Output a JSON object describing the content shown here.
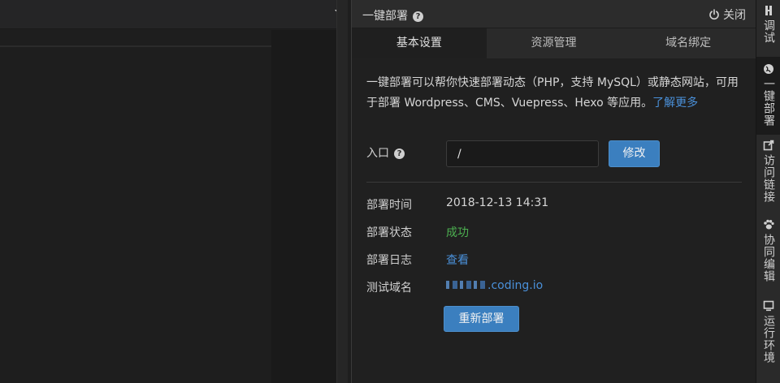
{
  "panel": {
    "title": "一键部署",
    "close_label": "关闭",
    "tabs": [
      "基本设置",
      "资源管理",
      "域名绑定"
    ],
    "description_text": "一键部署可以帮你快速部署动态（PHP，支持 MySQL）或静态网站，可用于部署 Wordpress、CMS、Vuepress、Hexo 等应用。",
    "learn_more_link": "了解更多",
    "entry_label": "入口",
    "entry_value": "/",
    "modify_button": "修改",
    "deploy_time_label": "部署时间",
    "deploy_time_value": "2018-12-13 14:31",
    "deploy_status_label": "部署状态",
    "deploy_status_value": "成功",
    "deploy_log_label": "部署日志",
    "deploy_log_value": "查看",
    "test_domain_label": "测试域名",
    "test_domain_value": ".coding.io",
    "redeploy_button": "重新部署"
  },
  "sidebar": {
    "items": [
      {
        "label": "调试",
        "icon": "debug-icon"
      },
      {
        "label": "一键部署",
        "icon": "globe-icon"
      },
      {
        "label": "访问链接",
        "icon": "external-link-icon"
      },
      {
        "label": "协同编辑",
        "icon": "paw-icon"
      },
      {
        "label": "运行环境",
        "icon": "monitor-icon"
      }
    ]
  },
  "colors": {
    "accent": "#3b7fbf",
    "link": "#4a90d9",
    "success": "#4caf50"
  }
}
